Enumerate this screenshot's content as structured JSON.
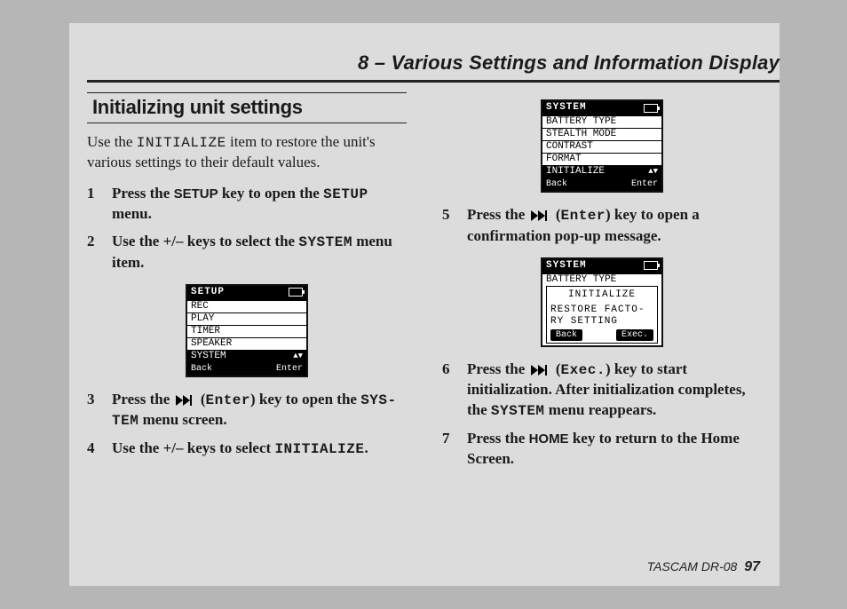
{
  "chapter_title": "8 – Various Settings and Information Display",
  "section_title": "Initializing unit settings",
  "intro_pre": "Use the ",
  "intro_mono": "INITIALIZE",
  "intro_post": " item to restore the unit's various settings to their default values.",
  "steps_left": {
    "s1_pre": "Press the ",
    "s1_key": "SETUP",
    "s1_mid": " key to open the ",
    "s1_mono": "SETUP",
    "s1_post": " menu.",
    "s2_pre": "Use the +/– keys to select the ",
    "s2_mono": "SYSTEM",
    "s2_post": " menu item.",
    "s3_pre": "Press the ",
    "s3_paren_open": " (",
    "s3_mono_enter": "Enter",
    "s3_mid": ") key to open the ",
    "s3_mono_sys": "SYS­TEM",
    "s3_post": " menu screen.",
    "s4_pre": "Use the +/– keys to select ",
    "s4_mono": "INITIALIZE",
    "s4_post": "."
  },
  "steps_right": {
    "s5_pre": "Press the ",
    "s5_paren_open": " (",
    "s5_mono": "Enter",
    "s5_post": ") key to open a confirmation pop-up message.",
    "s6_pre": "Press the ",
    "s6_paren_open": " (",
    "s6_mono": "Exec.",
    "s6_mid": ") key to start initialization. After initialization completes, the ",
    "s6_mono2": "SYSTEM",
    "s6_post": " menu reappears.",
    "s7_pre": "Press the ",
    "s7_key": "HOME",
    "s7_post": " key to return to the Home Screen."
  },
  "lcd1": {
    "title": "SETUP",
    "rows": [
      "REC",
      "PLAY",
      "TIMER",
      "SPEAKER",
      "SYSTEM"
    ],
    "selected": "SYSTEM",
    "back": "Back",
    "enter": "Enter"
  },
  "lcd2": {
    "title": "SYSTEM",
    "rows": [
      "BATTERY TYPE",
      "STEALTH MODE",
      "CONTRAST",
      "FORMAT",
      "INITIALIZE"
    ],
    "selected": "INITIALIZE",
    "back": "Back",
    "enter": "Enter"
  },
  "lcd3": {
    "title": "SYSTEM",
    "row0": "BATTERY TYPE",
    "popup_title": "INITIALIZE",
    "popup_msg1": "RESTORE FACTO-",
    "popup_msg2": "RY SETTING",
    "popup_back": "Back",
    "popup_exec": "Exec."
  },
  "footer_model": "TASCAM  DR-08",
  "footer_page": "97"
}
